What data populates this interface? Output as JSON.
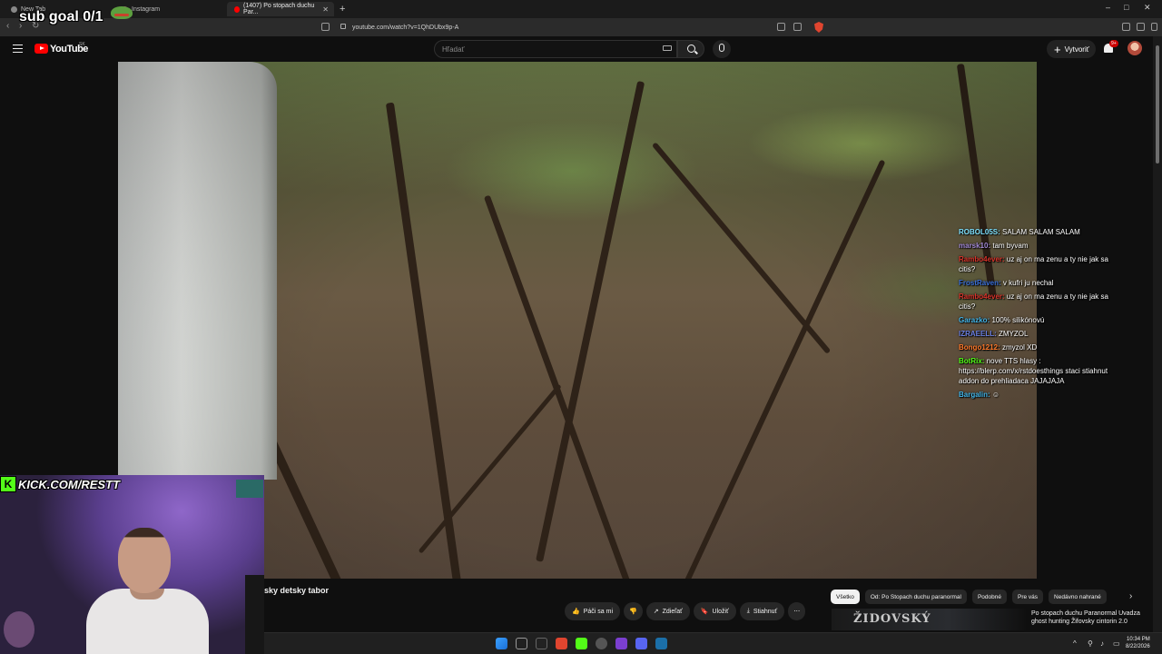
{
  "browser": {
    "tabs": [
      {
        "title": "New Tab"
      },
      {
        "title": "Instagram"
      },
      {
        "title": "(1407) Po stopach duchu Par..."
      }
    ],
    "url": "youtube.com/watch?v=1QhDUbx9p-A",
    "window_controls": [
      "–",
      "□",
      "✕"
    ]
  },
  "overlay": {
    "sub_goal": "sub goal 0/1",
    "kick_handle": "KICK.COM/RESTT"
  },
  "youtube": {
    "logo_text": "YouTube",
    "logo_country": "SK",
    "search_placeholder": "Hľadať",
    "create_label": "Vytvoriť",
    "notif_count": "9+"
  },
  "chat": [
    {
      "user": "ROBOL05S:",
      "text": " SALAM SALAM SALAM",
      "color": "#7fe2ff"
    },
    {
      "user": "marsk10:",
      "text": " tam byvam",
      "color": "#a48bd6"
    },
    {
      "user": "Rambo4ever:",
      "text": " uz aj on ma zenu a ty nie jak sa citis?",
      "color": "#d9342b"
    },
    {
      "user": "FrostRaven:",
      "text": " v kufri ju nechal",
      "color": "#3a6fd8"
    },
    {
      "user": "Rambo4ever:",
      "text": " uz aj on ma zenu a ty nie jak sa citis?",
      "color": "#d9342b"
    },
    {
      "user": "Garazko:",
      "text": " 100% silikónovú",
      "color": "#43b5e8"
    },
    {
      "user": "IZRAEELL:",
      "text": " ZMYZOL",
      "color": "#6a7fe0"
    },
    {
      "user": "Bongo1212:",
      "text": " zmyzol XD",
      "color": "#ff7a2b"
    },
    {
      "user": "BotRix:",
      "text": " nove TTS hlasy : https://blerp.com/x/rstdoesthings staci stiahnut addon do prehliadaca JAJAJAJA",
      "color": "#53fc18"
    },
    {
      "user": "Bargalin:",
      "text": " ☺",
      "color": "#43b5e8"
    }
  ],
  "video": {
    "title": "sky detsky tabor",
    "actions": [
      {
        "label": "Páči sa mi",
        "icon": "thumbs-up-icon"
      },
      {
        "label": "",
        "icon": "thumbs-down-icon"
      },
      {
        "label": "Zdieľať",
        "icon": "share-icon"
      },
      {
        "label": "Uložiť",
        "icon": "save-icon"
      },
      {
        "label": "Stiahnuť",
        "icon": "download-icon"
      },
      {
        "label": "⋯",
        "icon": "more-icon"
      }
    ]
  },
  "chips": [
    "Všetko",
    "Od: Po Stopach duchu paranormal",
    "Podobné",
    "Pre vás",
    "Nedávno nahrané"
  ],
  "recommendation": {
    "thumb_text": "ŽIDOVSKÝ",
    "title": "Po stopach duchu Paranormal Uvadza ghost hunting Žifovsky cintorin 2.0"
  },
  "taskbar": {
    "time": "10:34 PM",
    "date": "8/22/2026"
  },
  "colors": {
    "yt_red": "#ff0000",
    "kick_green": "#53fc18",
    "brave_orange": "#e0452f"
  }
}
